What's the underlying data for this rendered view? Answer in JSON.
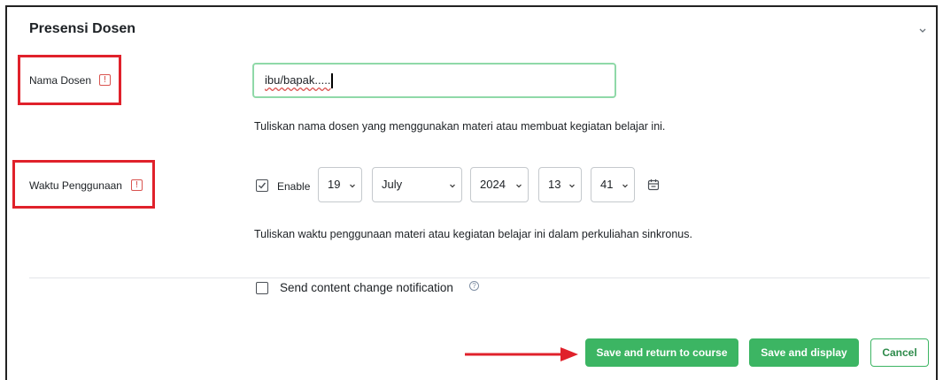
{
  "section": {
    "title": "Presensi Dosen"
  },
  "fields": {
    "nama_dosen": {
      "label": "Nama Dosen",
      "info_glyph": "!",
      "value": "ibu/bapak.....",
      "help": "Tuliskan nama dosen yang menggunakan materi atau membuat kegiatan belajar ini."
    },
    "waktu": {
      "label": "Waktu Penggunaan",
      "info_glyph": "!",
      "enable_label": "Enable",
      "enable_checked": true,
      "day": "19",
      "month": "July",
      "year": "2024",
      "hour": "13",
      "minute": "41",
      "help": "Tuliskan waktu penggunaan materi atau kegiatan belajar ini dalam perkuliahan sinkronus."
    }
  },
  "notification": {
    "label": "Send content change notification",
    "checked": false,
    "help_glyph": "?"
  },
  "buttons": {
    "save_return": "Save and return to course",
    "save_display": "Save and display",
    "cancel": "Cancel"
  },
  "icons": {
    "collapse": "chevron-down-icon",
    "calendar": "calendar-icon",
    "info": "info-icon",
    "help": "question-circle-icon"
  },
  "colors": {
    "accent_green": "#3cb563",
    "annotation_red": "#e0212b",
    "info_red": "#d9534f"
  }
}
